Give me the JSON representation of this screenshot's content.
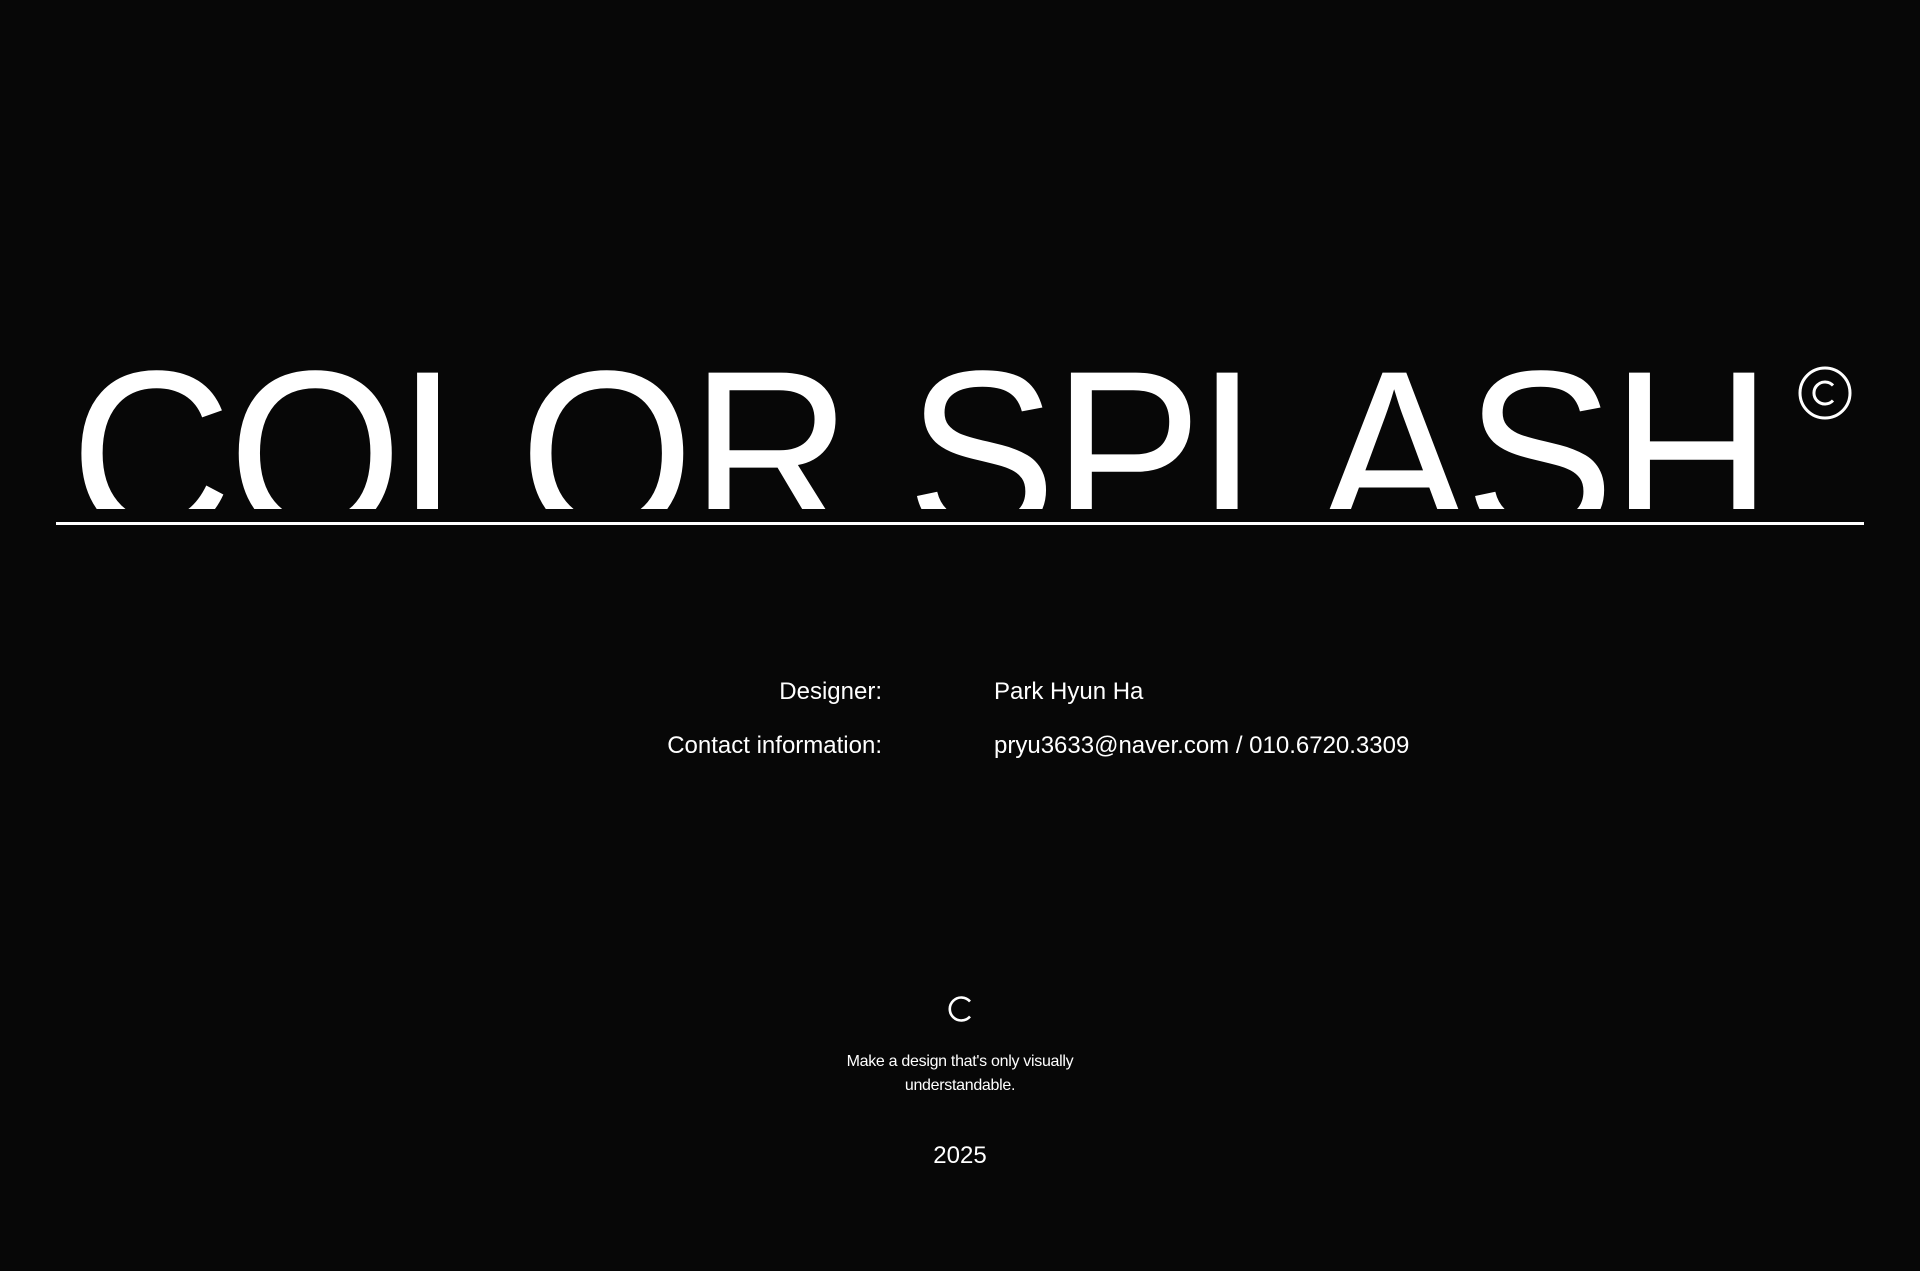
{
  "hero": {
    "title": "COLOR SPLASH",
    "copyright_icon": "copyright-icon"
  },
  "info": {
    "rows": [
      {
        "label": "Designer:",
        "value": "Park Hyun Ha"
      },
      {
        "label": "Contact information:",
        "value": "pryu3633@naver.com / 010.6720.3309"
      }
    ]
  },
  "footer": {
    "logo_icon": "c-logo-icon",
    "tagline": "Make a design that's only visually understandable.",
    "year": "2025"
  },
  "colors": {
    "background": "#070707",
    "foreground": "#ffffff"
  }
}
